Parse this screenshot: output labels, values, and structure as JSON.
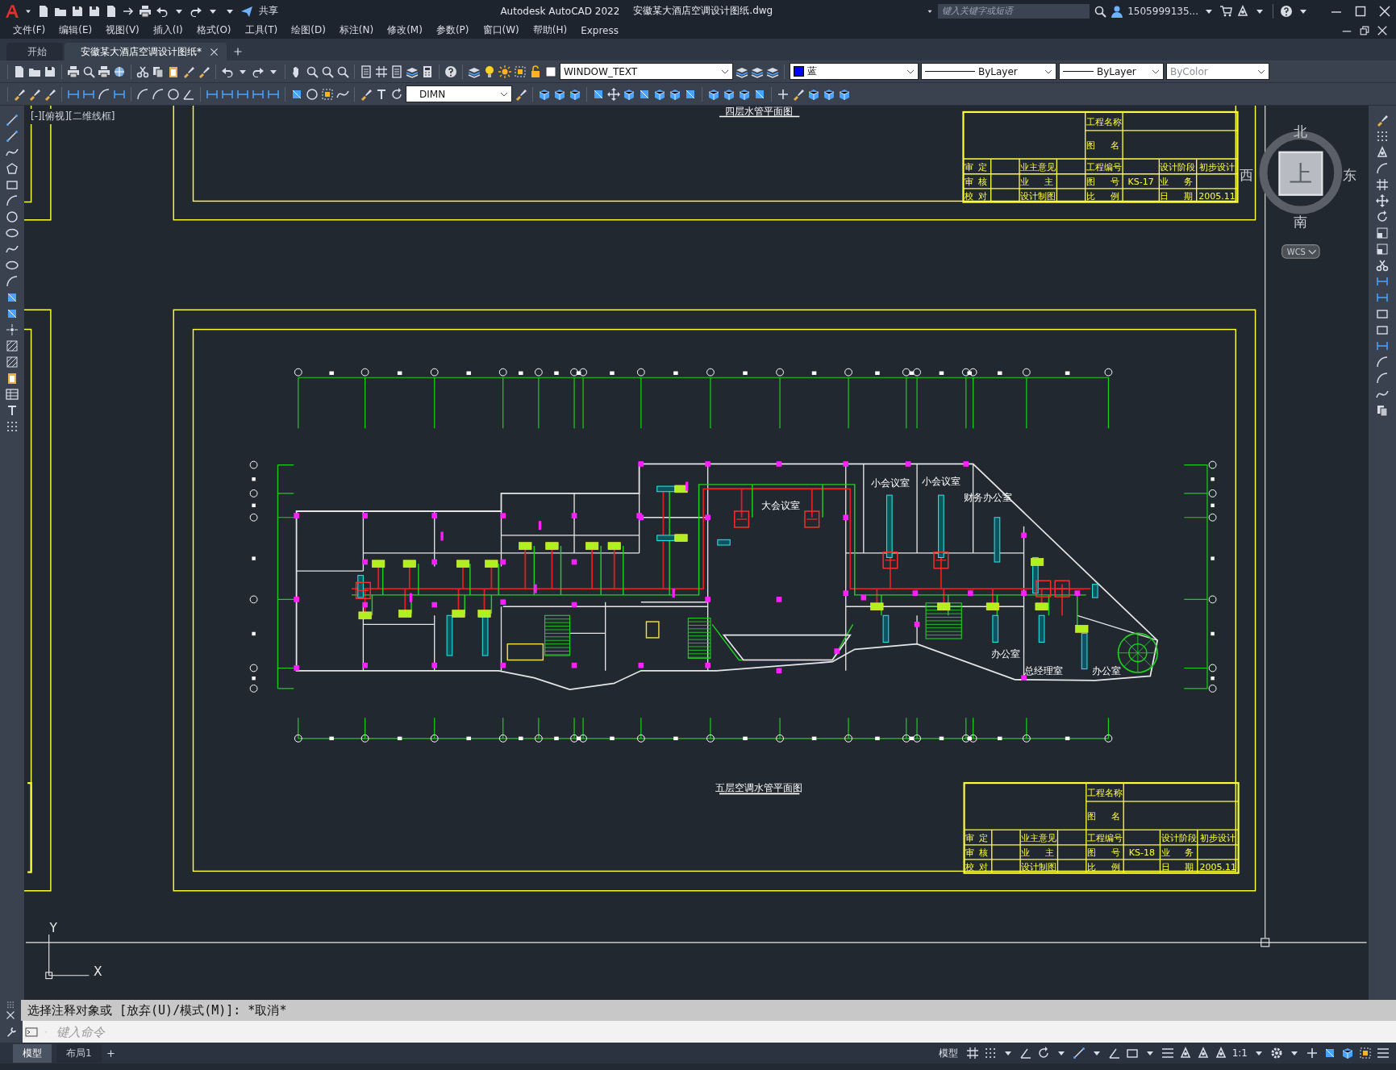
{
  "title_bar": {
    "share_label": "共享",
    "app_name": "Autodesk AutoCAD 2022",
    "file_name": "安徽某大酒店空调设计图纸.dwg",
    "search": {
      "placeholder": "键入关键字或短语"
    },
    "user": "1505999135..."
  },
  "menu_bar": [
    "文件(F)",
    "编辑(E)",
    "视图(V)",
    "插入(I)",
    "格式(O)",
    "工具(T)",
    "绘图(D)",
    "标注(N)",
    "修改(M)",
    "参数(P)",
    "窗口(W)",
    "帮助(H)",
    "Express"
  ],
  "file_tabs": [
    {
      "label": "开始",
      "selected": false
    },
    {
      "label": "安徽某大酒店空调设计图纸*",
      "selected": true
    }
  ],
  "properties_toolbar": {
    "layer": "WINDOW_TEXT",
    "color": {
      "label": "蓝",
      "color": "#0000ff"
    },
    "linetype": "ByLayer",
    "lineweight": "ByLayer",
    "plot_style": {
      "label": "ByColor",
      "disabled": true
    }
  },
  "dim_style": "DIMN",
  "viewport_label": "[-][俯视][二维线框]",
  "viewcube": {
    "north": "北",
    "south": "南",
    "east": "东",
    "west": "西",
    "face": "上",
    "ucs": "WCS"
  },
  "sheets": [
    {
      "title": "四层水管平面图",
      "title_block": [
        "工程名称",
        "图 名",
        "审 定",
        "业主意见",
        "工程编号",
        "设计阶段",
        "初步设计",
        "审 核",
        "业 主",
        "图 号",
        "KS-17",
        "业 务",
        "校 对",
        "设计制图",
        "比 例",
        "日 期",
        "2005.11"
      ]
    },
    {
      "title": "五层空调水管平面图",
      "title_block": [
        "工程名称",
        "图 名",
        "审 定",
        "业主意见",
        "工程编号",
        "设计阶段",
        "初步设计",
        "审 核",
        "业 主",
        "图 号",
        "KS-18",
        "业 务",
        "校 对",
        "设计制图",
        "比 例",
        "日 期",
        "2005.11"
      ]
    }
  ],
  "room_labels": [
    "大会议室",
    "小会议室",
    "小会议室",
    "财务办公室",
    "办公室",
    "总经理室",
    "办公室"
  ],
  "ucs_icon": {
    "y_label": "Y",
    "x_label": "X"
  },
  "command_line": {
    "history": "选择注释对象或 [放弃(U)/模式(M)]: *取消*",
    "placeholder": "键入命令"
  },
  "layout_tabs": [
    {
      "label": "模型",
      "selected": true
    },
    {
      "label": "布局1",
      "selected": false
    }
  ],
  "status_bar": {
    "model_button": "模型",
    "scale": "1:1"
  }
}
